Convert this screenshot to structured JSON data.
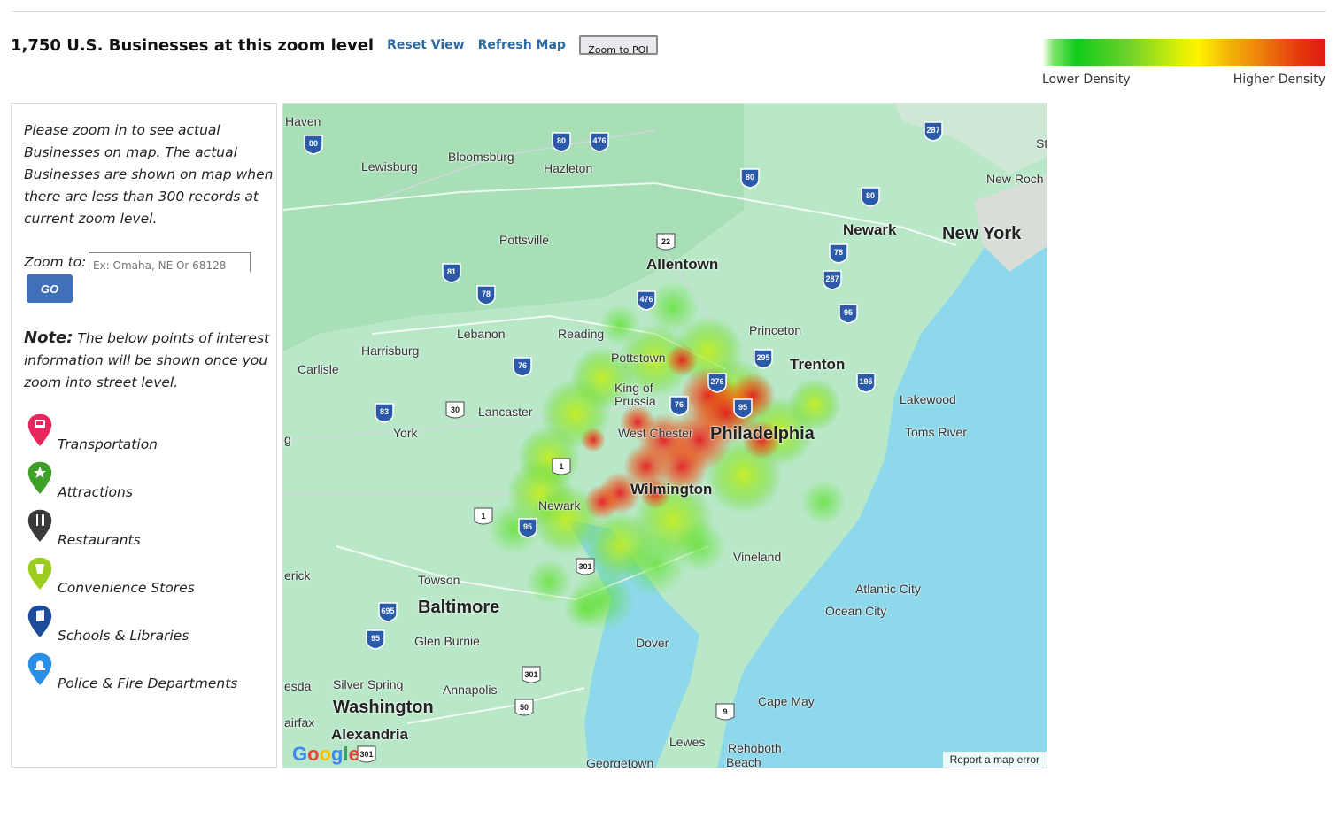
{
  "header": {
    "count_text": "1,750 U.S. Businesses at this zoom level",
    "reset_label": "Reset View",
    "refresh_label": "Refresh Map",
    "zoom_poi_label": "Zoom to POI"
  },
  "legend": {
    "low_label": "Lower Density",
    "high_label": "Higher Density"
  },
  "panel": {
    "intro": "Please zoom in to see actual Businesses on map. The actual Businesses are shown on map when there are less than 300 records at current zoom level.",
    "zoom_label": "Zoom to:",
    "zoom_placeholder": "Ex: Omaha, NE Or 68128",
    "go_label": "GO",
    "note_title": "Note:",
    "note_text": " The below points of interest information will be shown once you zoom into street level.",
    "poi": [
      {
        "label": "Transportation",
        "color": "#e8265b",
        "icon": "bus-pin-icon"
      },
      {
        "label": "Attractions",
        "color": "#3fa027",
        "icon": "star-pin-icon"
      },
      {
        "label": "Restaurants",
        "color": "#3a3a3a",
        "icon": "utensils-pin-icon"
      },
      {
        "label": "Convenience Stores",
        "color": "#9ccc1e",
        "icon": "cup-pin-icon"
      },
      {
        "label": "Schools & Libraries",
        "color": "#1d4d9a",
        "icon": "book-pin-icon"
      },
      {
        "label": "Police & Fire Departments",
        "color": "#2a8ee6",
        "icon": "siren-pin-icon"
      }
    ]
  },
  "map": {
    "labels": {
      "haven": "Haven",
      "lewisburg": "Lewisburg",
      "bloomsburg": "Bloomsburg",
      "hazleton": "Hazleton",
      "pottsville": "Pottsville",
      "allentown": "Allentown",
      "newark_nj": "Newark",
      "new_york": "New York",
      "new_roch": "New Roch",
      "st": "St",
      "lebanon": "Lebanon",
      "reading": "Reading",
      "harrisburg": "Harrisburg",
      "carlisle": "Carlisle",
      "princeton": "Princeton",
      "trenton": "Trenton",
      "pottstown": "Pottstown",
      "king_of_prussia": "King of Prussia",
      "lakewood": "Lakewood",
      "lancaster": "Lancaster",
      "york": "York",
      "west_chester": "West Chester",
      "philadelphia": "Philadelphia",
      "toms_river": "Toms River",
      "g": "g",
      "wilmington": "Wilmington",
      "newark_de": "Newark",
      "vineland": "Vineland",
      "erick": "erick",
      "towson": "Towson",
      "baltimore": "Baltimore",
      "atlantic_city": "Atlantic City",
      "ocean_city": "Ocean City",
      "glen_burnie": "Glen Burnie",
      "dover": "Dover",
      "esda": "esda",
      "silver_spring": "Silver Spring",
      "annapolis": "Annapolis",
      "washington": "Washington",
      "cape_may": "Cape May",
      "airfax": "airfax",
      "alexandria": "Alexandria",
      "lewes": "Lewes",
      "rehoboth": "Rehoboth",
      "beach": "Beach",
      "georgetown": "Georgetown"
    },
    "shields": [
      "80",
      "80",
      "476",
      "287",
      "80",
      "80",
      "22",
      "81",
      "78",
      "78",
      "476",
      "287",
      "95",
      "76",
      "276",
      "295",
      "195",
      "83",
      "30",
      "76",
      "95",
      "1",
      "1",
      "95",
      "301",
      "695",
      "95",
      "301",
      "50",
      "9",
      "301"
    ],
    "report_label": "Report a map error",
    "google_logo": "Google"
  }
}
